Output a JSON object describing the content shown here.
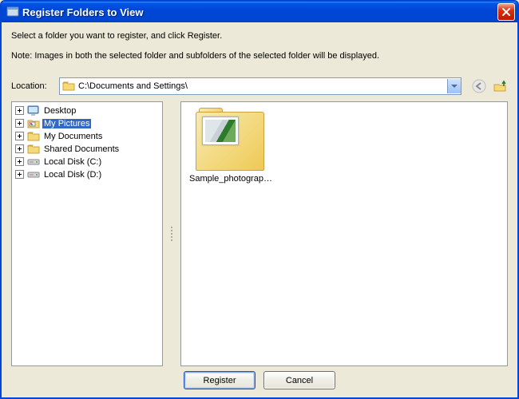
{
  "window": {
    "title": "Register Folders to View"
  },
  "text": {
    "instruction": "Select a folder you want to register, and click Register.",
    "note": "Note: Images in both the selected folder and subfolders of the selected folder will be displayed."
  },
  "location": {
    "label": "Location:",
    "path": "C:\\Documents and Settings\\"
  },
  "tree": {
    "items": [
      {
        "label": "Desktop",
        "icon": "desktop",
        "selected": false
      },
      {
        "label": "My Pictures",
        "icon": "pictures",
        "selected": true
      },
      {
        "label": "My Documents",
        "icon": "folder",
        "selected": false
      },
      {
        "label": "Shared Documents",
        "icon": "folder",
        "selected": false
      },
      {
        "label": "Local Disk (C:)",
        "icon": "drive",
        "selected": false
      },
      {
        "label": "Local Disk (D:)",
        "icon": "drive",
        "selected": false
      }
    ]
  },
  "content": {
    "items": [
      {
        "caption": "Sample_photography"
      }
    ]
  },
  "buttons": {
    "register": "Register",
    "cancel": "Cancel"
  },
  "icons": {
    "app": "app-icon",
    "close": "close-icon",
    "back": "back-icon",
    "up": "folder-up-icon",
    "desktop": "desktop-icon",
    "pictures": "pictures-icon",
    "folder": "folder-icon",
    "drive": "drive-icon",
    "location": "folder-icon",
    "chevron": "chevron-down-icon"
  }
}
